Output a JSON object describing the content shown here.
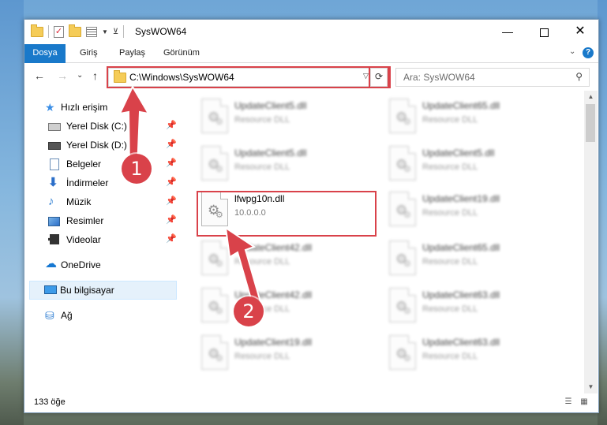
{
  "window": {
    "title": "SysWOW64",
    "controls": {
      "minimize": "—",
      "maximize": "",
      "close": "✕"
    }
  },
  "ribbon": {
    "tabs": [
      "Dosya",
      "Giriş",
      "Paylaş",
      "Görünüm"
    ],
    "help": "?"
  },
  "nav": {
    "back": "←",
    "forward": "→",
    "recent": "⌄",
    "up": "↑",
    "address": "C:\\Windows\\SysWOW64",
    "search_placeholder": "Ara: SysWOW64"
  },
  "sidebar": {
    "quick_access": "Hızlı erişim",
    "items": [
      {
        "label": "Yerel Disk (C:)",
        "icon": "drive-icon"
      },
      {
        "label": "Yerel Disk (D:)",
        "icon": "drive-icon"
      },
      {
        "label": "Belgeler",
        "icon": "documents-icon"
      },
      {
        "label": "İndirmeler",
        "icon": "downloads-icon"
      },
      {
        "label": "Müzik",
        "icon": "music-icon"
      },
      {
        "label": "Resimler",
        "icon": "pictures-icon"
      },
      {
        "label": "Videolar",
        "icon": "videos-icon"
      }
    ],
    "onedrive": "OneDrive",
    "this_pc": "Bu bilgisayar",
    "network": "Ağ"
  },
  "files": [
    {
      "name": "UpdateClient5.dll",
      "desc": "Resource DLL"
    },
    {
      "name": "UpdateClient65.dll",
      "desc": "Resource DLL"
    },
    {
      "name": "UpdateClient5.dll",
      "desc": "Resource DLL"
    },
    {
      "name": "UpdateClient5.dll",
      "desc": "Resource DLL"
    },
    {
      "name": "lfwpg10n.dll",
      "desc": "10.0.0.0"
    },
    {
      "name": "UpdateClient19.dll",
      "desc": "Resource DLL"
    },
    {
      "name": "UpdateClient42.dll",
      "desc": "Resource DLL"
    },
    {
      "name": "UpdateClient65.dll",
      "desc": "Resource DLL"
    },
    {
      "name": "UpdateClient42.dll",
      "desc": "Resource DLL"
    },
    {
      "name": "UpdateClient63.dll",
      "desc": "Resource DLL"
    },
    {
      "name": "UpdateClient19.dll",
      "desc": "Resource DLL"
    },
    {
      "name": "UpdateClient63.dll",
      "desc": "Resource DLL"
    }
  ],
  "status": {
    "count": "133 öğe"
  },
  "annotations": {
    "step1": "1",
    "step2": "2",
    "color": "#d9424a"
  }
}
